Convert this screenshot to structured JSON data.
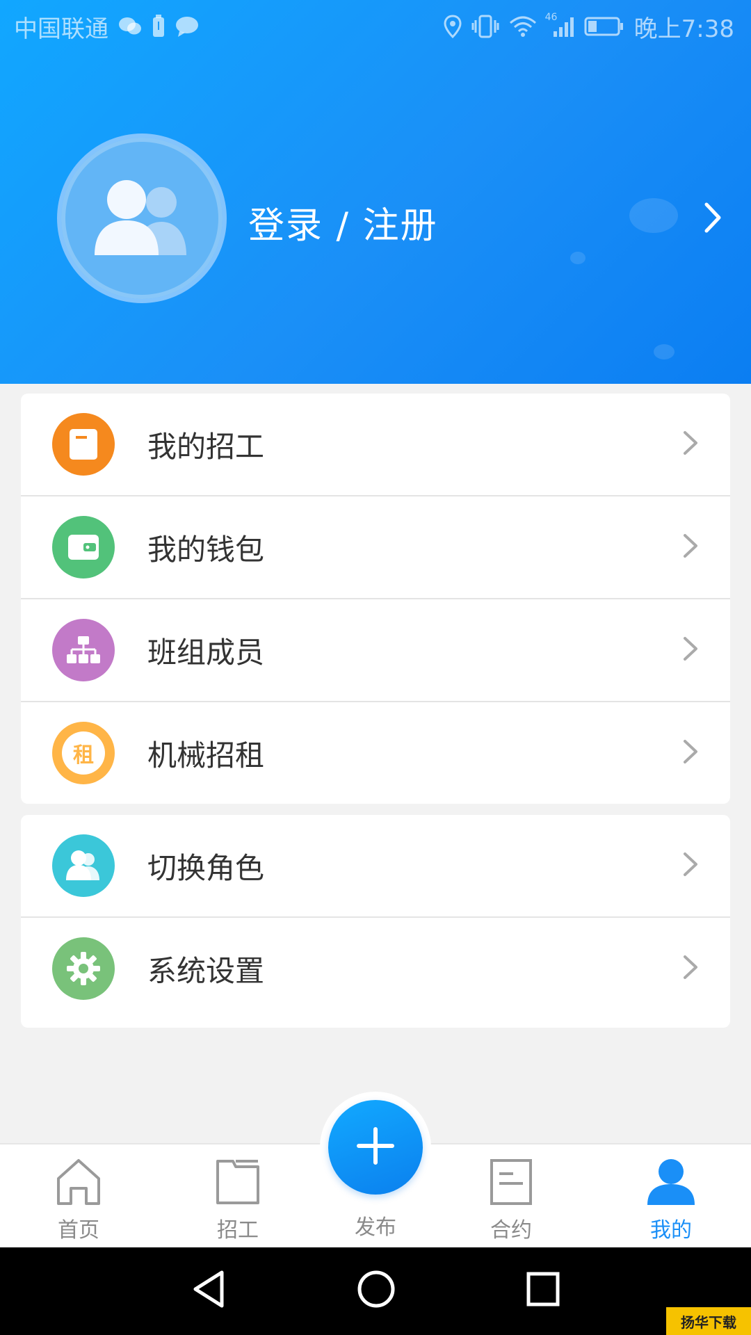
{
  "status_bar": {
    "carrier": "中国联通",
    "network": "46",
    "time": "晚上7:38"
  },
  "header": {
    "login_label": "登录 / 注册",
    "avatar_icon": "users-icon",
    "chevron_icon": "chevron-right-icon"
  },
  "menu_group_1": {
    "items": [
      {
        "label": "我的招工",
        "icon": "document-icon",
        "color": "#f5891e"
      },
      {
        "label": "我的钱包",
        "icon": "wallet-icon",
        "color": "#52c27a"
      },
      {
        "label": "班组成员",
        "icon": "org-chart-icon",
        "color": "#c27ac8"
      },
      {
        "label": "机械招租",
        "icon": "rent-icon",
        "color": "#ffb547",
        "glyph": "租"
      }
    ]
  },
  "menu_group_2": {
    "items": [
      {
        "label": "切换角色",
        "icon": "switch-role-icon",
        "color": "#3bc7d9"
      },
      {
        "label": "系统设置",
        "icon": "gear-icon",
        "color": "#79c27a"
      }
    ]
  },
  "tab_bar": {
    "tabs": [
      {
        "label": "首页",
        "icon": "home-icon",
        "active": false
      },
      {
        "label": "招工",
        "icon": "folder-icon",
        "active": false
      },
      {
        "label": "合约",
        "icon": "contract-icon",
        "active": false
      },
      {
        "label": "我的",
        "icon": "user-icon",
        "active": true
      }
    ],
    "publish_label": "发布",
    "publish_icon": "plus-icon"
  },
  "colors": {
    "brand": "#1a8ff7",
    "inactive": "#8a8a8a"
  },
  "watermark": {
    "text": "扬华下载"
  }
}
